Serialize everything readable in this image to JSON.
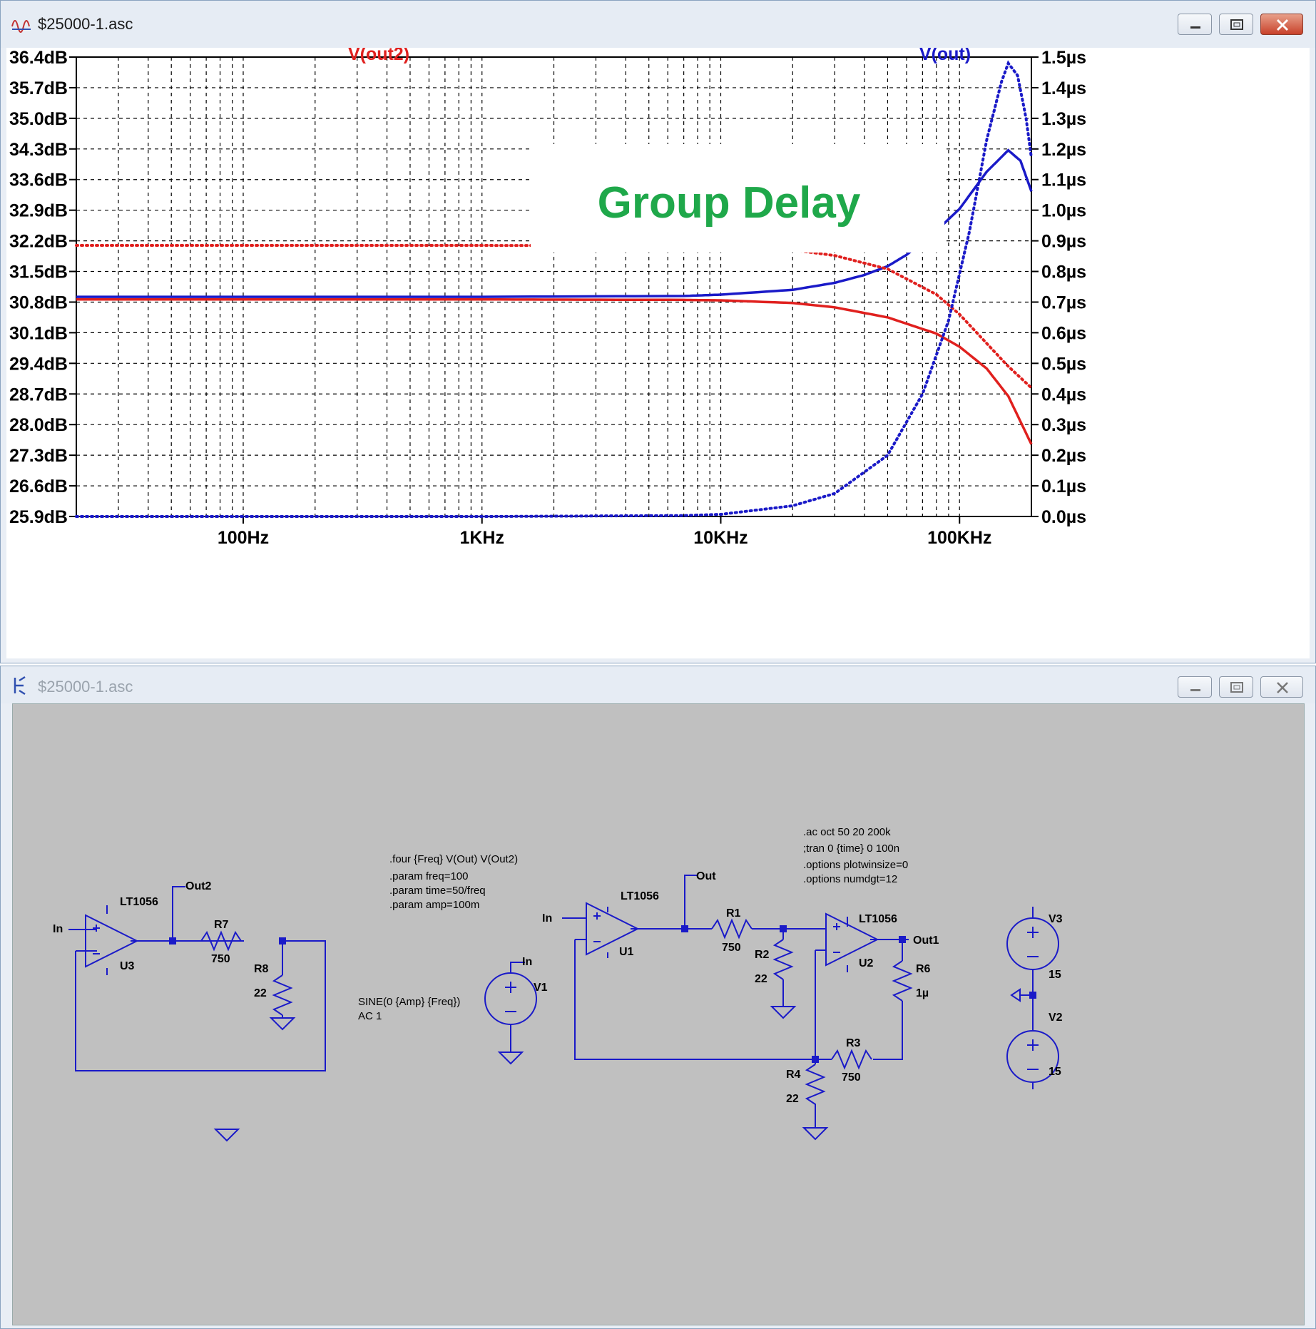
{
  "plot_window": {
    "title": "$25000-1.asc",
    "trace_labels": [
      {
        "label": "V(out2)",
        "color": "#e0201e"
      },
      {
        "label": "V(out)",
        "color": "#1a1ac8"
      }
    ],
    "annotation": "Group Delay",
    "annotation_color": "#1fa84a"
  },
  "chart_data": {
    "type": "line",
    "x_scale": "log",
    "xlim": [
      20,
      200000
    ],
    "x_ticks": [
      "100Hz",
      "1KHz",
      "10KHz",
      "100KHz"
    ],
    "y_left_ticks": [
      "36.4dB",
      "35.7dB",
      "35.0dB",
      "34.3dB",
      "33.6dB",
      "32.9dB",
      "32.2dB",
      "31.5dB",
      "30.8dB",
      "30.1dB",
      "29.4dB",
      "28.7dB",
      "28.0dB",
      "27.3dB",
      "26.6dB",
      "25.9dB"
    ],
    "y_right_ticks": [
      "1.5µs",
      "1.4µs",
      "1.3µs",
      "1.2µs",
      "1.1µs",
      "1.0µs",
      "0.9µs",
      "0.8µs",
      "0.7µs",
      "0.6µs",
      "0.5µs",
      "0.4µs",
      "0.3µs",
      "0.2µs",
      "0.1µs",
      "0.0µs"
    ],
    "ylim_left": [
      25.9,
      36.4
    ],
    "ylim_right": [
      0.0,
      1.5
    ],
    "grid": true,
    "series": [
      {
        "name": "V(out2)",
        "quantity": "gain",
        "axis": "left",
        "style": "solid",
        "color": "#e0201e",
        "x": [
          20,
          1000,
          7000,
          10000,
          20000,
          30000,
          50000,
          80000,
          100000,
          130000,
          160000,
          200000
        ],
        "y": [
          30.86,
          30.86,
          30.85,
          30.84,
          30.78,
          30.68,
          30.45,
          30.08,
          29.78,
          29.28,
          28.65,
          27.55
        ]
      },
      {
        "name": "V(out)",
        "quantity": "gain",
        "axis": "left",
        "style": "solid",
        "color": "#1a1ac8",
        "x": [
          20,
          1000,
          7000,
          10000,
          20000,
          30000,
          40000,
          50000,
          60000,
          80000,
          100000,
          130000,
          160000,
          180000,
          200000
        ],
        "y": [
          30.92,
          30.92,
          30.94,
          30.97,
          31.08,
          31.24,
          31.42,
          31.62,
          31.88,
          32.43,
          32.93,
          33.78,
          34.27,
          34.03,
          33.33
        ]
      },
      {
        "name": "V(out2)",
        "quantity": "group delay",
        "axis": "right",
        "style": "dotted",
        "color": "#e0201e",
        "x": [
          20,
          1000,
          7000,
          10000,
          20000,
          30000,
          50000,
          80000,
          100000,
          130000,
          160000,
          200000
        ],
        "y": [
          0.885,
          0.885,
          0.884,
          0.882,
          0.87,
          0.852,
          0.808,
          0.725,
          0.66,
          0.565,
          0.49,
          0.42
        ]
      },
      {
        "name": "V(out)",
        "quantity": "group delay",
        "axis": "right",
        "style": "dotted",
        "color": "#1a1ac8",
        "x": [
          20,
          1000,
          7000,
          10000,
          20000,
          30000,
          50000,
          70000,
          90000,
          110000,
          130000,
          150000,
          160000,
          175000,
          190000,
          200000
        ],
        "y": [
          0.0,
          0.0,
          0.003,
          0.007,
          0.035,
          0.075,
          0.2,
          0.4,
          0.64,
          0.93,
          1.23,
          1.42,
          1.48,
          1.44,
          1.3,
          1.17
        ]
      }
    ]
  },
  "schematic_window": {
    "title": "$25000-1.asc",
    "directives_four": [
      ".four {Freq} V(Out) V(Out2)",
      ".param freq=100",
      ".param time=50/freq",
      ".param amp=100m"
    ],
    "directives_ac": [
      ".ac oct 50 20 200k",
      ";tran 0 {time} 0 100n",
      ".options plotwinsize=0",
      ".options numdgt=12"
    ],
    "labels": {
      "in_left": "In",
      "out2": "Out2",
      "lt1056_u3": "LT1056",
      "u3": "U3",
      "r7": "R7",
      "r7_val": "750",
      "r8": "R8",
      "r8_val": "22",
      "source_spec_1": "SINE(0 {Amp} {Freq})",
      "source_spec_2": "AC 1",
      "v1": "V1",
      "in_v1": "In",
      "in_u1": "In",
      "lt1056_u1": "LT1056",
      "u1": "U1",
      "out": "Out",
      "r1": "R1",
      "r1_val": "750",
      "r2": "R2",
      "r2_val": "22",
      "lt1056_u2": "LT1056",
      "u2": "U2",
      "out1": "Out1",
      "r6": "R6",
      "r6_val": "1µ",
      "r3": "R3",
      "r3_val": "750",
      "r4": "R4",
      "r4_val": "22",
      "v3": "V3",
      "v3_val": "15",
      "v2": "V2",
      "v2_val": "15"
    }
  }
}
